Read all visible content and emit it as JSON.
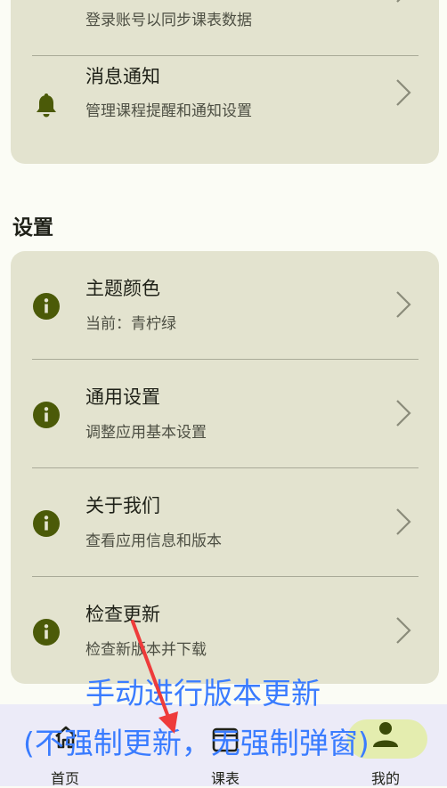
{
  "account_card": {
    "sync_row": {
      "subtitle": "登录账号以同步课表数据"
    },
    "notify_row": {
      "title": "消息通知",
      "subtitle": "管理课程提醒和通知设置",
      "icon": "bell-icon"
    }
  },
  "settings": {
    "section_title": "设置",
    "items": [
      {
        "title": "主题颜色",
        "subtitle": "当前：青柠绿",
        "icon": "info-icon"
      },
      {
        "title": "通用设置",
        "subtitle": "调整应用基本设置",
        "icon": "info-icon"
      },
      {
        "title": "关于我们",
        "subtitle": "查看应用信息和版本",
        "icon": "info-icon"
      },
      {
        "title": "检查更新",
        "subtitle": "检查新版本并下载",
        "icon": "info-icon"
      }
    ]
  },
  "nav": {
    "items": [
      {
        "label": "首页",
        "icon": "home-icon"
      },
      {
        "label": "课表",
        "icon": "calendar-icon"
      },
      {
        "label": "我的",
        "icon": "person-icon",
        "selected": true
      }
    ]
  },
  "annotation": {
    "line1": "手动进行版本更新",
    "line2": "(不强制更新，无强制弹窗)"
  },
  "colors": {
    "background": "#fbfcf5",
    "card": "#e3e3cf",
    "icon": "#4b5a08",
    "annotation_text": "#3a7cff",
    "annotation_arrow": "#ee3b3b",
    "nav_pill": "#e4edaf"
  }
}
